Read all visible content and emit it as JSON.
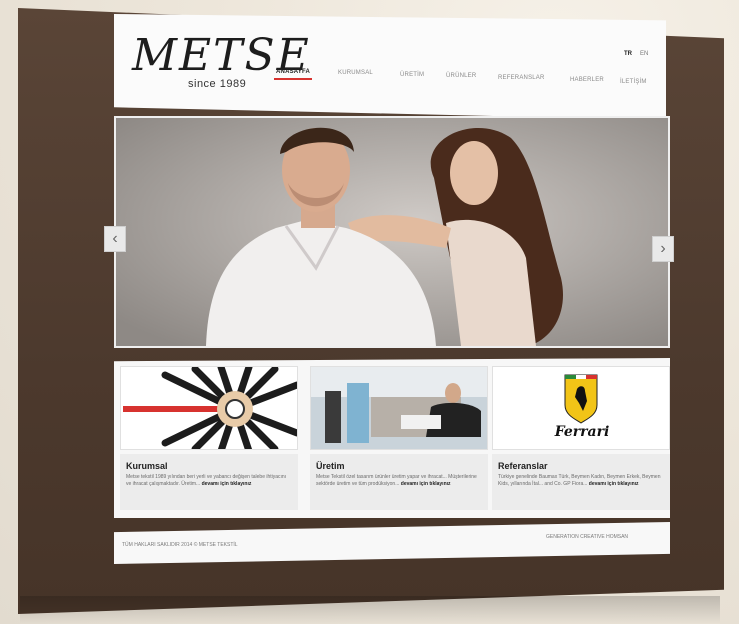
{
  "logo": {
    "name": "METSE",
    "since": "since 1989"
  },
  "languages": [
    {
      "code": "TR",
      "active": true
    },
    {
      "code": "EN",
      "active": false
    }
  ],
  "nav": [
    {
      "label": "ANASAYFA",
      "active": true
    },
    {
      "label": "KURUMSAL",
      "active": false
    },
    {
      "label": "ÜRETİM",
      "active": false
    },
    {
      "label": "ÜRÜNLER",
      "active": false
    },
    {
      "label": "REFERANSLAR",
      "active": false
    },
    {
      "label": "HABERLER",
      "active": false
    },
    {
      "label": "İLETİŞİM",
      "active": false
    }
  ],
  "slider": {
    "prev_icon": "chevron-left-icon",
    "next_icon": "chevron-right-icon",
    "prev_glyph": "‹",
    "next_glyph": "›"
  },
  "cards": [
    {
      "title": "Kurumsal",
      "text": "Metse tekstil 1989 yılından beri yerli ve yabancı değişen talebe ihtiyacını ve ihracat çalışmaktadır. Üretim...",
      "more": "devamı için tıklayınız"
    },
    {
      "title": "Üretim",
      "text": "Metse Tekstil özel tasarım ürünler üretim yapar ve ihracat... Müşterilerine sektörde üretim ve tüm prodüksiyon...",
      "more": "devamı için tıklayınız"
    },
    {
      "title": "Referanslar",
      "text": "Türkiye genelinde Baumax Türk, Beymen Kadın, Beymen Erkek, Beymen Kids, yıllarında İtal... and Co. GP Fiora...",
      "more": "devamı için tıklayınız"
    }
  ],
  "ferrari_label": "Ferrari",
  "footer": {
    "copyright": "TÜM HAKLARI SAKLIDIR 2014 © METSE TEKSTİL",
    "credit": "GENERATION CREATIVE HOMSAN"
  },
  "colors": {
    "accent": "#d7322f",
    "board": "#4c392d",
    "card_body": "#ececec"
  }
}
